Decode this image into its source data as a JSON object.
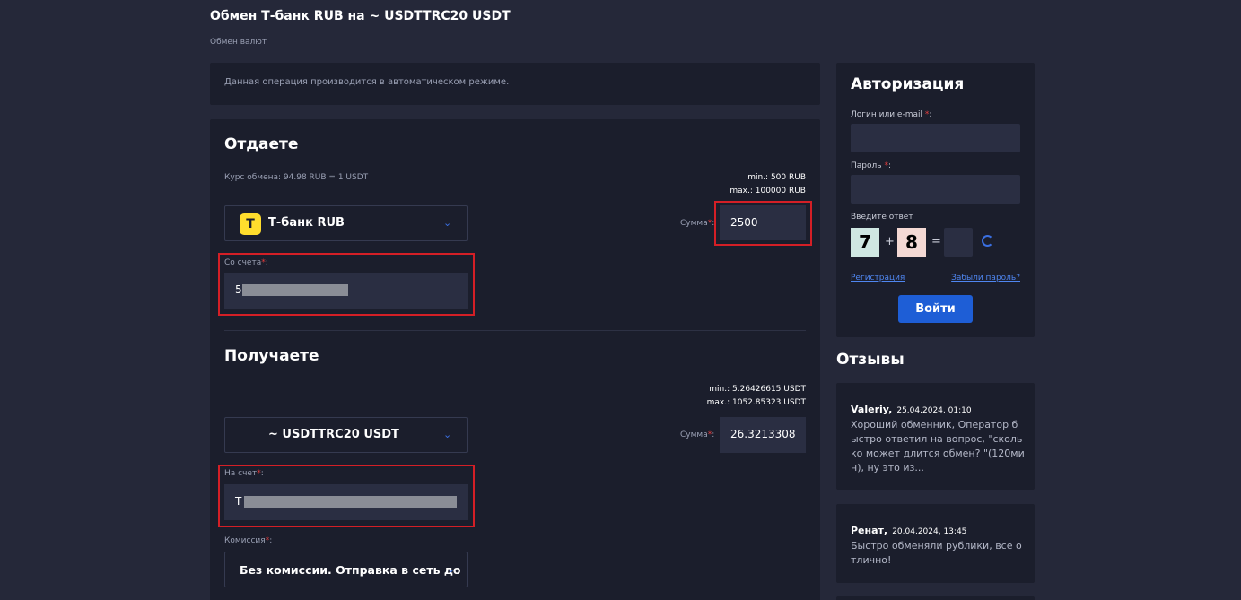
{
  "header": {
    "title": "Обмен Т-банк RUB на ~ USDTTRC20 USDT",
    "breadcrumb": "Обмен валют"
  },
  "notice": "Данная операция производится в автоматическом режиме.",
  "give": {
    "title": "Отдаете",
    "rate": "Курс обмена: 94.98 RUB = 1 USDT",
    "min": "min.: 500 RUB",
    "max": "max.: 100000 RUB",
    "currency": "Т-банк RUB",
    "currency_logo": "Т",
    "amount_label": "Сумма",
    "amount_value": "2500",
    "account_label": "Со счета",
    "account_value": "5"
  },
  "get": {
    "title": "Получаете",
    "min": "min.: 5.26426615 USDT",
    "max": "max.: 1052.85323 USDT",
    "currency": "~ USDTTRC20 USDT",
    "amount_label": "Сумма",
    "amount_value": "26.3213308",
    "account_label": "На счет",
    "account_value": "T",
    "commission_label": "Комиссия",
    "commission_value": "Без комиссии. Отправка в сеть до"
  },
  "auth": {
    "title": "Авторизация",
    "login_label": "Логин или e-mail",
    "password_label": "Пароль",
    "captcha_label": "Введите ответ",
    "captcha_a": "7",
    "captcha_op": "+",
    "captcha_b": "8",
    "captcha_eq": "=",
    "register_link": "Регистрация",
    "forgot_link": "Забыли пароль?",
    "login_button": "Войти"
  },
  "reviews": {
    "title": "Отзывы",
    "items": [
      {
        "author": "Valeriy,",
        "date": "25.04.2024, 01:10",
        "text": "Хороший обменник, Оператор б ыстро ответил на вопрос, \"сколь ко может длится обмен? \"(120ми н), ну это из..."
      },
      {
        "author": "Ренат,",
        "date": "20.04.2024, 13:45",
        "text": "Быстро обменяли рублики, все о тлично!"
      }
    ]
  },
  "colors": {
    "accent": "#1e5ed6",
    "highlight": "#d41f26",
    "brand_yellow": "#ffdd2d"
  }
}
